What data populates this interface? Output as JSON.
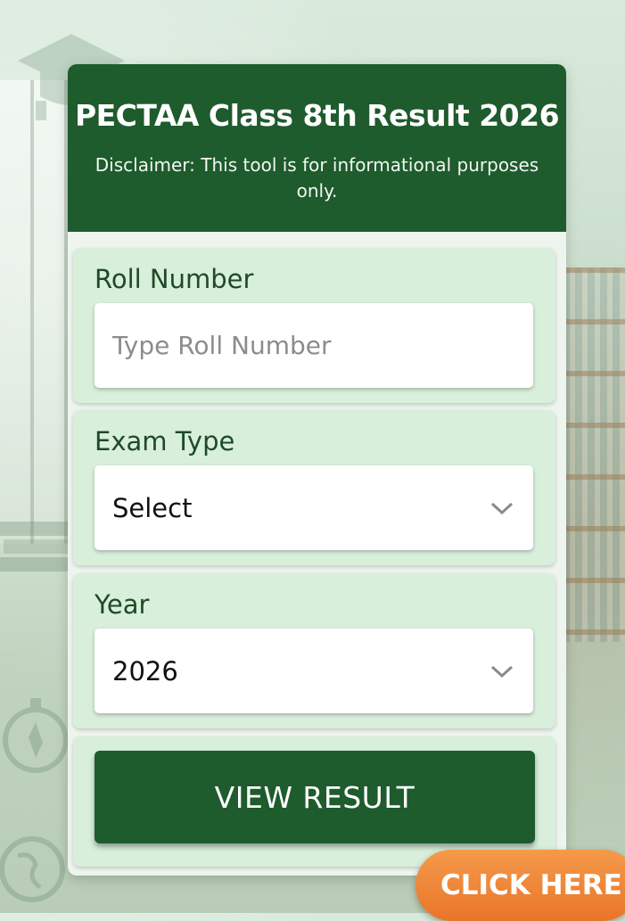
{
  "header": {
    "title": "PECTAA Class 8th Result 2026",
    "disclaimer": "Disclaimer: This tool is for informational purposes only."
  },
  "form": {
    "roll_number": {
      "label": "Roll Number",
      "placeholder": "Type Roll Number",
      "value": ""
    },
    "exam_type": {
      "label": "Exam Type",
      "selected": "Select"
    },
    "year": {
      "label": "Year",
      "selected": "2026"
    },
    "submit_label": "VIEW RESULT"
  },
  "cta": {
    "label": "CLICK HERE"
  },
  "colors": {
    "primary_green": "#1e5b2d",
    "section_bg": "#d8efdb",
    "cta_orange": "#ee8236"
  },
  "background_icons": [
    "graduation-cap-icon",
    "books-icon",
    "compass-icon",
    "globe-icon"
  ]
}
